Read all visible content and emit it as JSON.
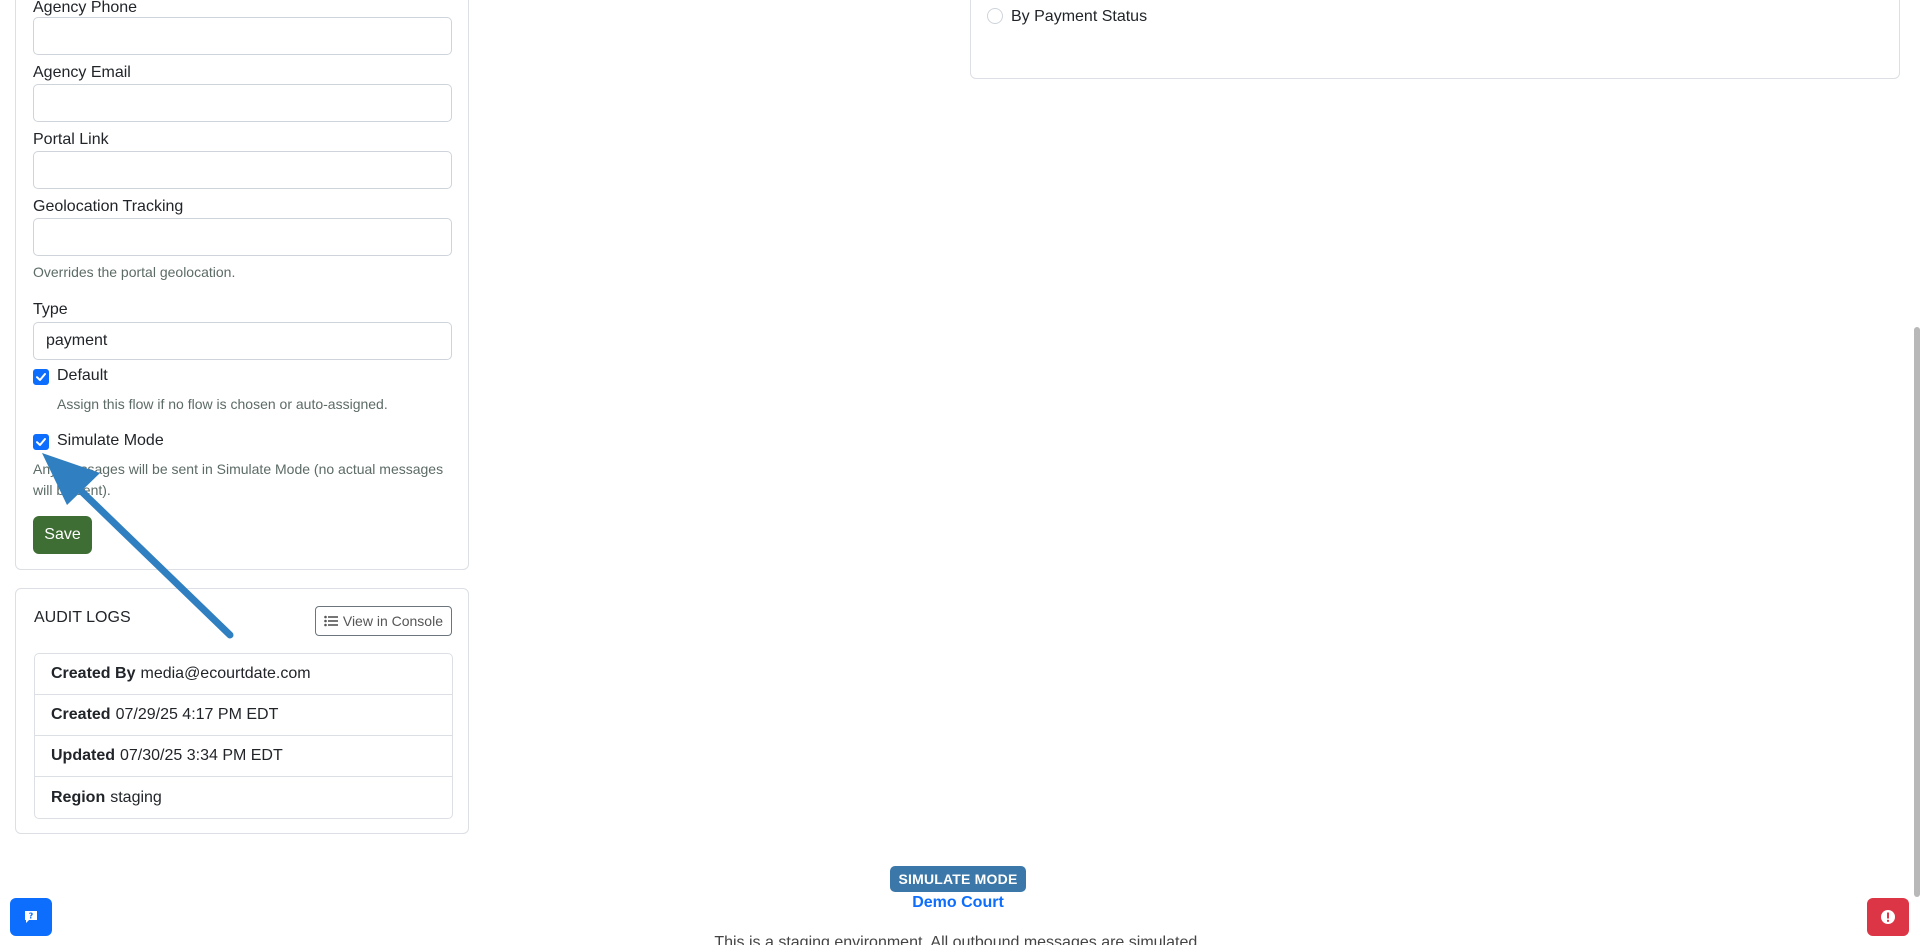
{
  "form": {
    "agency_phone_label": "Agency Phone",
    "agency_phone_value": "",
    "agency_email_label": "Agency Email",
    "agency_email_value": "",
    "portal_link_label": "Portal Link",
    "portal_link_value": "",
    "geolocation_label": "Geolocation Tracking",
    "geolocation_value": "",
    "geolocation_help": "Overrides the portal geolocation.",
    "type_label": "Type",
    "type_value": "payment",
    "default_label": "Default",
    "default_help": "Assign this flow if no flow is chosen or auto-assigned.",
    "simulate_label": "Simulate Mode",
    "simulate_help_line1": "Any messages will be sent in Simulate Mode (no actual messages",
    "simulate_help_line2": "will be sent).",
    "save_label": "Save"
  },
  "audit": {
    "title": "AUDIT LOGS",
    "console_button": "View in Console",
    "rows": [
      {
        "label": "Created By",
        "value": "media@ecourtdate.com"
      },
      {
        "label": "Created",
        "value": "07/29/25 4:17 PM EDT"
      },
      {
        "label": "Updated",
        "value": "07/30/25 3:34 PM EDT"
      },
      {
        "label": "Region",
        "value": "staging"
      }
    ]
  },
  "filters": {
    "payment_status_label": "By Payment Status"
  },
  "footer": {
    "badge": "SIMULATE MODE",
    "court": "Demo Court",
    "staging_text": "This is a staging environment. All outbound messages are simulated."
  },
  "colors": {
    "save": "#3e6e34",
    "primary": "#0d6efd",
    "badge": "#3b77a8",
    "danger": "#dc3545",
    "arrow": "#2f7fc1"
  },
  "icons": {
    "console": "list-icon",
    "help": "chat-question-icon",
    "alert": "exclamation-icon",
    "annotation": "arrow-annotation"
  }
}
